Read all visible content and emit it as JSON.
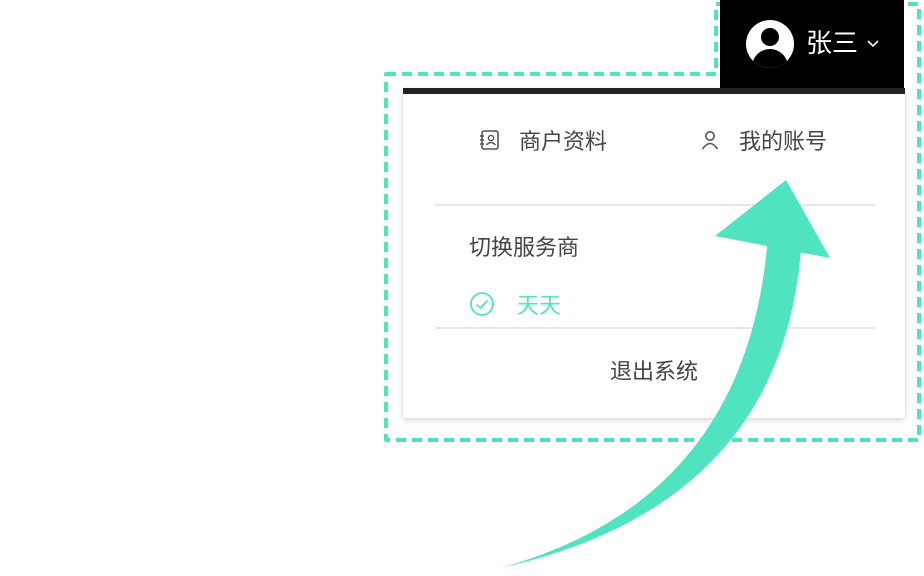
{
  "header": {
    "username": "张三"
  },
  "menu": {
    "merchant_label": "商户资料",
    "account_label": "我的账号",
    "section_title": "切换服务商",
    "provider_name": "天天",
    "logout_label": "退出系统"
  },
  "colors": {
    "accent": "#4fe3bf",
    "topbar_bg": "#000000",
    "text": "#444444"
  },
  "icons": {
    "user": "user-circle-icon",
    "merchant": "merchant-profile-icon",
    "account": "person-icon",
    "check": "check-circle-icon",
    "chevron": "chevron-down-icon"
  }
}
